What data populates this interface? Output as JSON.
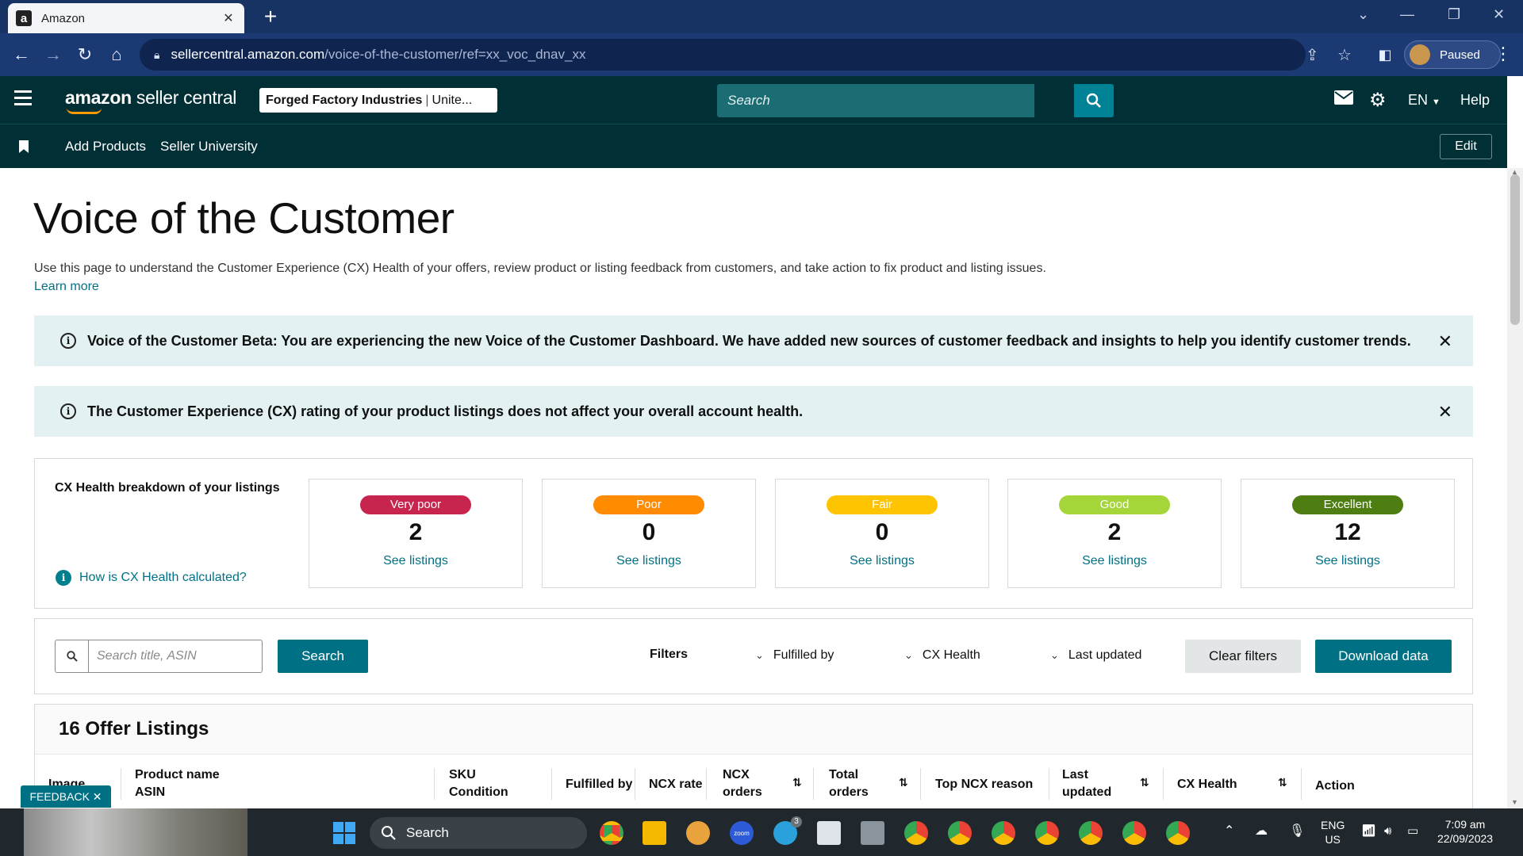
{
  "browser": {
    "tab_title": "Amazon",
    "tab_favicon": "a",
    "url_host": "sellercentral.amazon.com",
    "url_path": "/voice-of-the-customer/ref=xx_voc_dnav_xx",
    "profile_label": "Paused"
  },
  "header": {
    "logo_bold": "amazon",
    "logo_rest": " seller central",
    "store_name": "Forged Factory Industries",
    "store_region": "Unite...",
    "search_placeholder": "Search",
    "language": "EN",
    "help": "Help"
  },
  "subnav": {
    "items": [
      "Add Products",
      "Seller University"
    ],
    "edit_label": "Edit"
  },
  "page": {
    "title": "Voice of the Customer",
    "intro": "Use this page to understand the Customer Experience (CX) Health of your offers, review product or listing feedback from customers, and take action to fix product and listing issues.",
    "learn_more": "Learn more"
  },
  "alerts": [
    {
      "text": "Voice of the Customer Beta: You are experiencing the new Voice of the Customer Dashboard. We have added new sources of customer feedback and insights to help you identify customer trends."
    },
    {
      "text": "The Customer Experience (CX) rating of your product listings does not affect your overall account health."
    }
  ],
  "cx_health": {
    "heading": "CX Health breakdown of your listings",
    "help_link": "How is CX Health calculated?",
    "tiles": [
      {
        "label": "Very poor",
        "count": "2",
        "link": "See listings",
        "color": "#c7254e"
      },
      {
        "label": "Poor",
        "count": "0",
        "link": "See listings",
        "color": "#ff8c00"
      },
      {
        "label": "Fair",
        "count": "0",
        "link": "See listings",
        "color": "#ffc400"
      },
      {
        "label": "Good",
        "count": "2",
        "link": "See listings",
        "color": "#a4d63a"
      },
      {
        "label": "Excellent",
        "count": "12",
        "link": "See listings",
        "color": "#4e7d12"
      }
    ]
  },
  "filters": {
    "search_placeholder": "Search title, ASIN",
    "search_button": "Search",
    "filters_label": "Filters",
    "dropdowns": [
      "Fulfilled by",
      "CX Health",
      "Last updated"
    ],
    "clear_button": "Clear filters",
    "download_button": "Download data"
  },
  "listings": {
    "heading": "16 Offer Listings",
    "columns": {
      "image": "Image",
      "product_name": "Product name",
      "asin": "ASIN",
      "sku": "SKU",
      "condition": "Condition",
      "fulfilled_by": "Fulfilled by",
      "ncx_rate": "NCX rate",
      "ncx_orders_1": "NCX",
      "ncx_orders_2": "orders",
      "total_orders_1": "Total",
      "total_orders_2": "orders",
      "top_ncx_reason": "Top NCX reason",
      "last_updated_1": "Last",
      "last_updated_2": "updated",
      "cx_health": "CX Health",
      "action": "Action"
    }
  },
  "feedback_tab": "FEEDBACK ✕",
  "taskbar": {
    "search": "Search",
    "lang_1": "ENG",
    "lang_2": "US",
    "time": "7:09 am",
    "date": "22/09/2023",
    "telegram_badge": "3",
    "zoom_label": "zoom"
  },
  "colors": {
    "seller_header": "#002f36",
    "teal": "#007185",
    "alert_bg": "#e3f1f2",
    "browser_tabbar": "#163363"
  }
}
